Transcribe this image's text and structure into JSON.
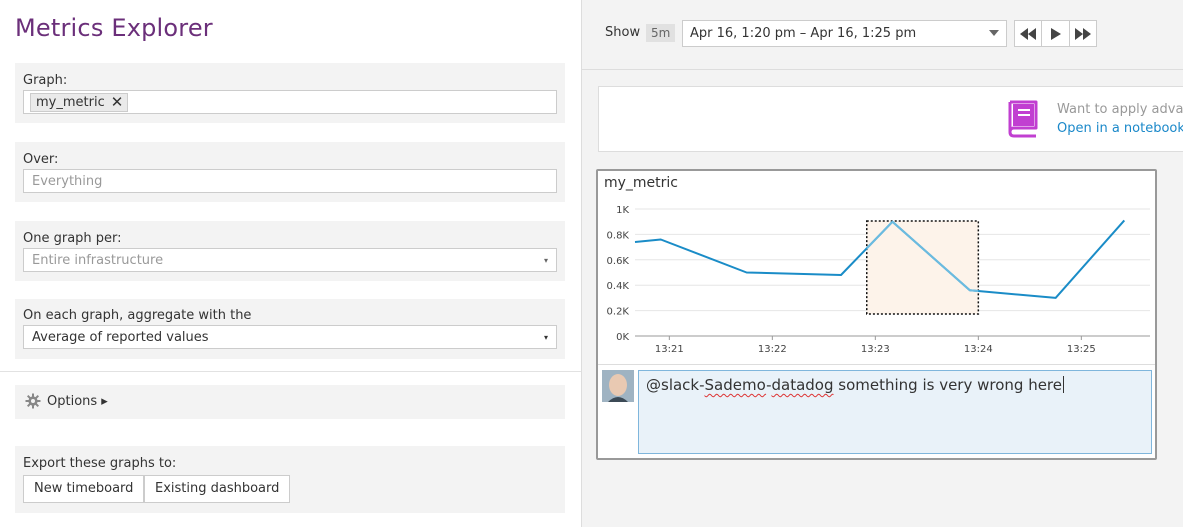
{
  "title": "Metrics Explorer",
  "graph_section": {
    "label": "Graph:",
    "tag": "my_metric"
  },
  "over_section": {
    "label": "Over:",
    "placeholder": "Everything"
  },
  "per_section": {
    "label": "One graph per:",
    "value": "Entire infrastructure"
  },
  "aggregate_section": {
    "label": "On each graph, aggregate with the",
    "value": "Average of reported values"
  },
  "options": {
    "label": "Options ▸"
  },
  "export": {
    "label": "Export these graphs to:",
    "new_button": "New timeboard",
    "existing_button": "Existing dashboard"
  },
  "topbar": {
    "show_label": "Show",
    "range_badge": "5m",
    "time_range": "Apr 16, 1:20 pm – Apr 16, 1:25 pm"
  },
  "notebook": {
    "text": "Want to apply advanc",
    "link": "Open in a notebook"
  },
  "graph": {
    "title": "my_metric"
  },
  "comment": {
    "mention": "@slack-Sademo-datadog",
    "message": " something is very wrong here"
  },
  "colors": {
    "accent": "#6b2f7a",
    "line": "#1a8cc7",
    "line_highlight": "#6bbbe0",
    "selection": "#fdf3ea",
    "notebook_icon": "#c13fd1"
  },
  "chart_data": {
    "type": "line",
    "x": [
      "13:20:40",
      "13:20:55",
      "13:21:45",
      "13:22:40",
      "13:23:10",
      "13:23:55",
      "13:24:45",
      "13:25:25"
    ],
    "values": [
      740,
      760,
      500,
      480,
      900,
      360,
      300,
      910
    ],
    "x_ticks": [
      "13:21",
      "13:22",
      "13:23",
      "13:24",
      "13:25"
    ],
    "y_ticks": [
      "0K",
      "0.2K",
      "0.4K",
      "0.6K",
      "0.8K",
      "1K"
    ],
    "ylim": [
      0,
      1000
    ],
    "grid": "horizontal",
    "selection": [
      "13:22:55",
      "13:24:00"
    ]
  }
}
